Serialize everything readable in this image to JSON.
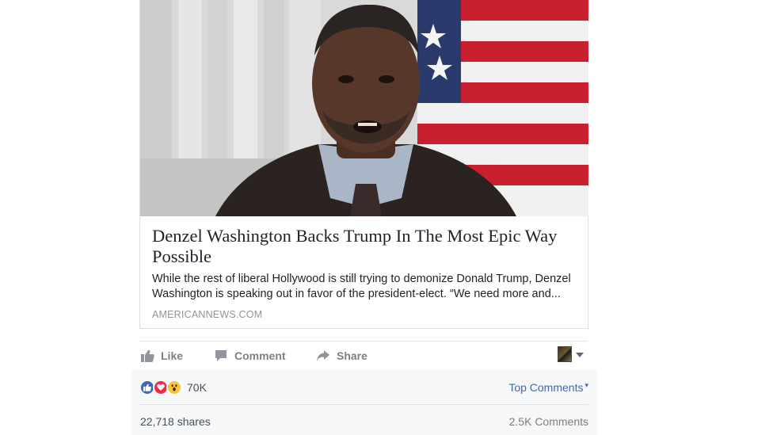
{
  "link_preview": {
    "title": "Denzel Washington Backs Trump In The Most Epic Way Possible",
    "description": "While the rest of liberal Hollywood is still trying to demonize Donald Trump, Denzel Washington is speaking out in favor of the president-elect. “We need more and...",
    "domain": "AMERICANNEWS.COM"
  },
  "actions": {
    "like": "Like",
    "comment": "Comment",
    "share": "Share"
  },
  "reactions": {
    "icons": [
      "like-reaction-icon",
      "love-reaction-icon",
      "wow-reaction-icon"
    ],
    "count": "70K"
  },
  "sort": {
    "label": "Top Comments"
  },
  "stats": {
    "shares": "22,718 shares",
    "comments": "2.5K Comments"
  },
  "colors": {
    "link_blue": "#4267b2",
    "like_blue": "#4267b2",
    "love_red": "#f0284a",
    "wow_yellow": "#f7c53a",
    "muted_gray": "#7f7f7f"
  }
}
